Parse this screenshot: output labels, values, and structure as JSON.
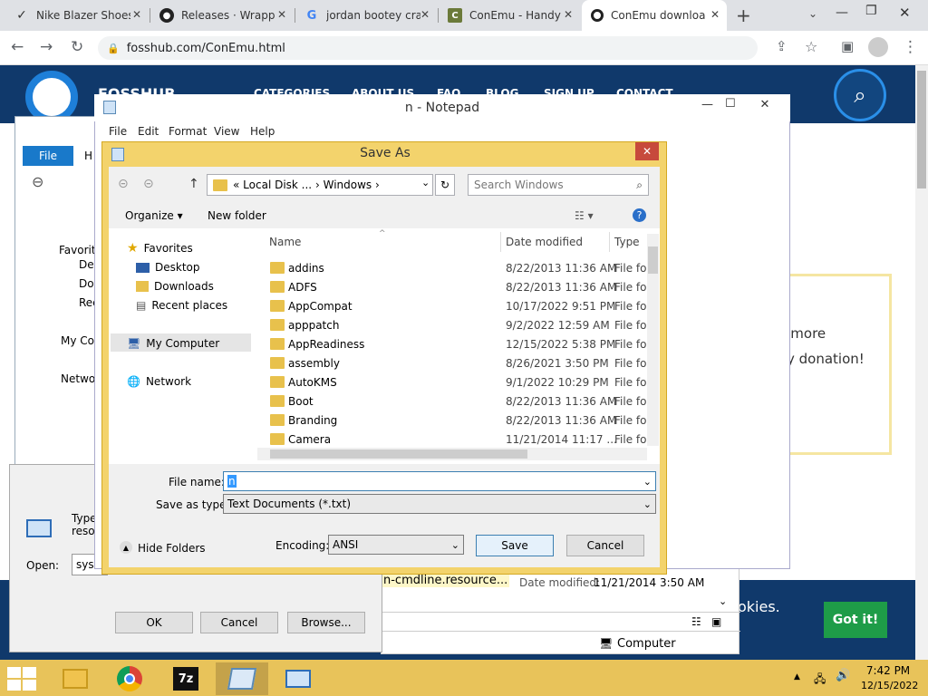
{
  "browser": {
    "tabs": [
      {
        "title": "Nike Blazer Shoes",
        "icon": "nike-icon"
      },
      {
        "title": "Releases · Wrapper",
        "icon": "github-icon"
      },
      {
        "title": "jordan bootey cra",
        "icon": "google-icon"
      },
      {
        "title": "ConEmu - Handy",
        "icon": "conemu-icon"
      },
      {
        "title": "ConEmu download",
        "icon": "fosshub-icon",
        "active": true
      }
    ],
    "new_tab": "+",
    "url": "fosshub.com/ConEmu.html"
  },
  "site": {
    "logo": "FOSSHUB",
    "nav": [
      "CATEGORIES",
      "ABOUT US",
      "FAQ",
      "BLOG",
      "SIGN UP",
      "CONTACT"
    ],
    "donate_line1": "g more",
    "donate_line2": "y donation!",
    "file_row": "n-cmdline.resource...",
    "file_date_label": "Date modified:",
    "file_date": "11/21/2014 3:50 AM",
    "cookie_text": "okies.",
    "got_it": "Got it!",
    "status_computer": "Computer"
  },
  "explorer": {
    "file_tab": "File",
    "home_tab": "H",
    "tree": [
      "Favorit",
      "Des",
      "Dov",
      "Rec",
      "My Co",
      "Netwo"
    ]
  },
  "run": {
    "type_text": "Type",
    "res_text": "resou",
    "open_label": "Open:",
    "open_value": "sysk",
    "ok": "OK",
    "cancel": "Cancel",
    "browse": "Browse..."
  },
  "notepad": {
    "title": "n - Notepad",
    "menu": [
      "File",
      "Edit",
      "Format",
      "View",
      "Help"
    ]
  },
  "saveas": {
    "title": "Save As",
    "breadcrumb": [
      "«",
      "Local Disk ...",
      "›",
      "Windows",
      "›"
    ],
    "search_placeholder": "Search Windows",
    "organize": "Organize ▾",
    "new_folder": "New folder",
    "nav": [
      {
        "label": "Favorites",
        "icon": "star-icon"
      },
      {
        "label": "Desktop",
        "icon": "desktop-icon"
      },
      {
        "label": "Downloads",
        "icon": "downloads-icon"
      },
      {
        "label": "Recent places",
        "icon": "recent-icon"
      },
      {
        "label": "My Computer",
        "icon": "computer-icon"
      },
      {
        "label": "Network",
        "icon": "network-icon"
      }
    ],
    "columns": [
      "Name",
      "Date modified",
      "Type"
    ],
    "rows": [
      {
        "name": "addins",
        "date": "8/22/2013 11:36 AM",
        "type": "File fol"
      },
      {
        "name": "ADFS",
        "date": "8/22/2013 11:36 AM",
        "type": "File fol"
      },
      {
        "name": "AppCompat",
        "date": "10/17/2022 9:51 PM",
        "type": "File fol"
      },
      {
        "name": "apppatch",
        "date": "9/2/2022 12:59 AM",
        "type": "File fol"
      },
      {
        "name": "AppReadiness",
        "date": "12/15/2022 5:38 PM",
        "type": "File fol"
      },
      {
        "name": "assembly",
        "date": "8/26/2021 3:50 PM",
        "type": "File fol"
      },
      {
        "name": "AutoKMS",
        "date": "9/1/2022 10:29 PM",
        "type": "File fol"
      },
      {
        "name": "Boot",
        "date": "8/22/2013 11:36 AM",
        "type": "File fol"
      },
      {
        "name": "Branding",
        "date": "8/22/2013 11:36 AM",
        "type": "File fol"
      },
      {
        "name": "Camera",
        "date": "11/21/2014 11:17 ...",
        "type": "File fol"
      }
    ],
    "file_name_label": "File name:",
    "file_name_value": "n",
    "save_type_label": "Save as type:",
    "save_type_value": "Text Documents (*.txt)",
    "hide_folders": "Hide Folders",
    "encoding_label": "Encoding:",
    "encoding_value": "ANSI",
    "save": "Save",
    "cancel": "Cancel"
  },
  "taskbar": {
    "time": "7:42 PM",
    "date": "12/15/2022"
  },
  "colors": {
    "accent": "#10396b",
    "taskbar": "#e8c35a",
    "gotit": "#1e9c48"
  }
}
